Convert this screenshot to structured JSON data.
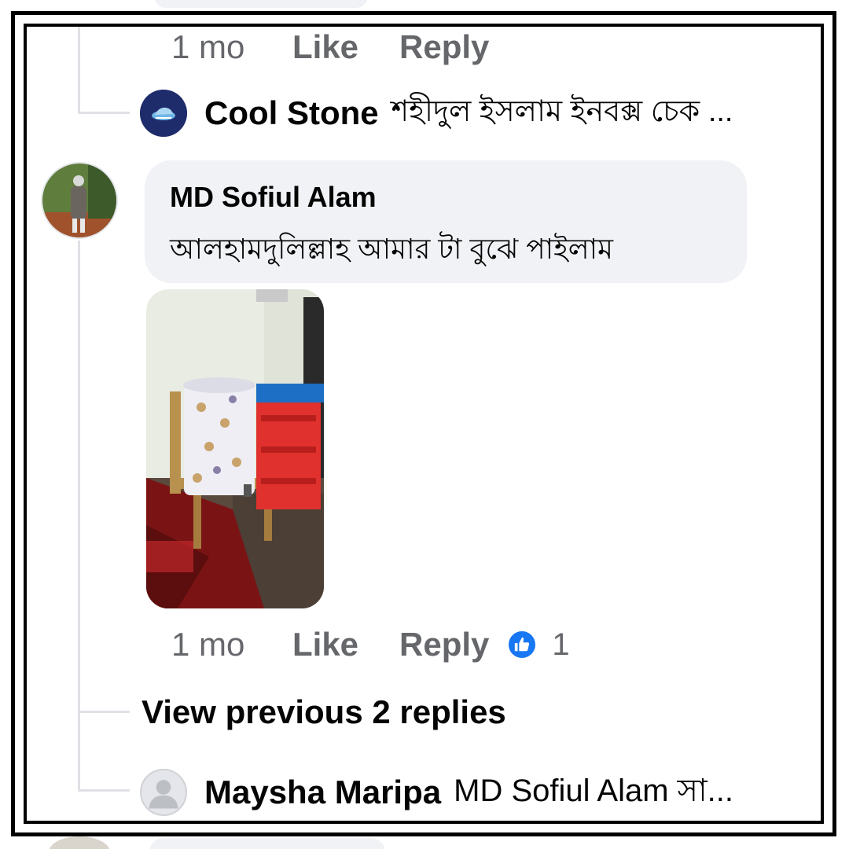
{
  "top_comment": {
    "time": "1 mo",
    "like_label": "Like",
    "reply_label": "Reply"
  },
  "cool_stone_reply": {
    "author": "Cool Stone",
    "text": "শহীদুল ইসলাম ইনবক্স চেক ..."
  },
  "main_comment": {
    "author": "MD Sofiul Alam",
    "text": "আলহামদুলিল্লাহ আমার টা বুঝে পাইলাম",
    "time": "1 mo",
    "like_label": "Like",
    "reply_label": "Reply",
    "reaction_icon": "like-thumb-icon",
    "reaction_count": "1"
  },
  "view_previous": "View previous 2 replies",
  "maysha_reply": {
    "author": "Maysha Maripa",
    "text": "MD Sofiul Alam সা..."
  },
  "colors": {
    "bubble_bg": "#f0f2f5",
    "meta_text": "#65676b",
    "like_blue": "#1877f2",
    "thread_line": "#dfe1e5",
    "avatar_navy": "#1f2c6b"
  }
}
